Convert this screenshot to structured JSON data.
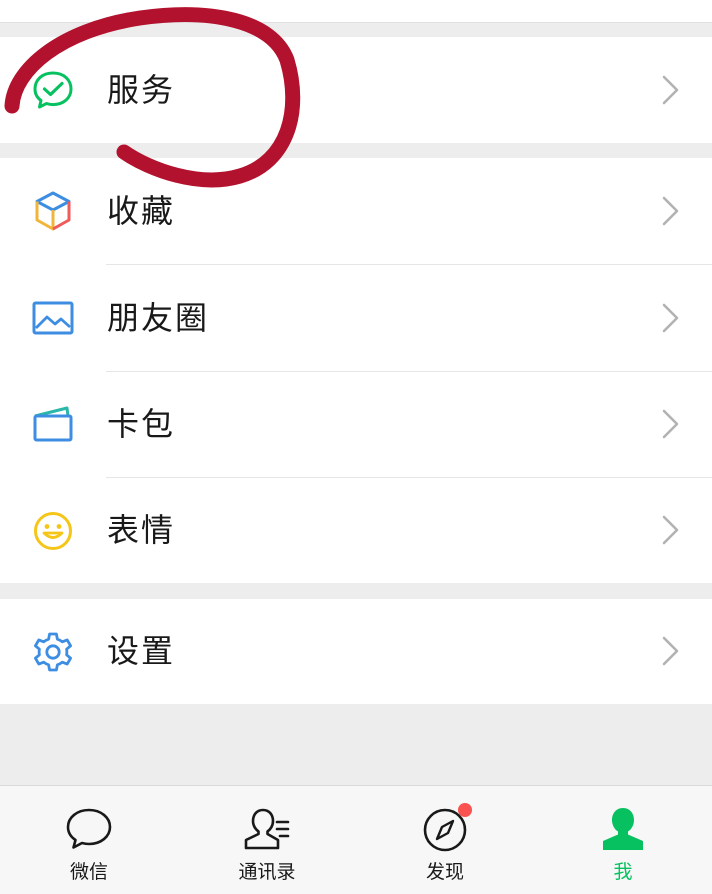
{
  "menu": {
    "service": {
      "label": "服务"
    },
    "favorites": {
      "label": "收藏"
    },
    "moments": {
      "label": "朋友圈"
    },
    "cards": {
      "label": "卡包"
    },
    "stickers": {
      "label": "表情"
    },
    "settings": {
      "label": "设置"
    }
  },
  "tabbar": {
    "chats": {
      "label": "微信"
    },
    "contacts": {
      "label": "通讯录"
    },
    "discover": {
      "label": "发现"
    },
    "me": {
      "label": "我"
    }
  },
  "colors": {
    "accent": "#07c160",
    "badge": "#fa5151",
    "annotation": "#b3122e"
  },
  "icons": {
    "service": "service-check-bubble-icon",
    "favorites": "cube-icon",
    "moments": "picture-icon",
    "cards": "wallet-card-icon",
    "stickers": "smiley-icon",
    "settings": "gear-icon"
  }
}
